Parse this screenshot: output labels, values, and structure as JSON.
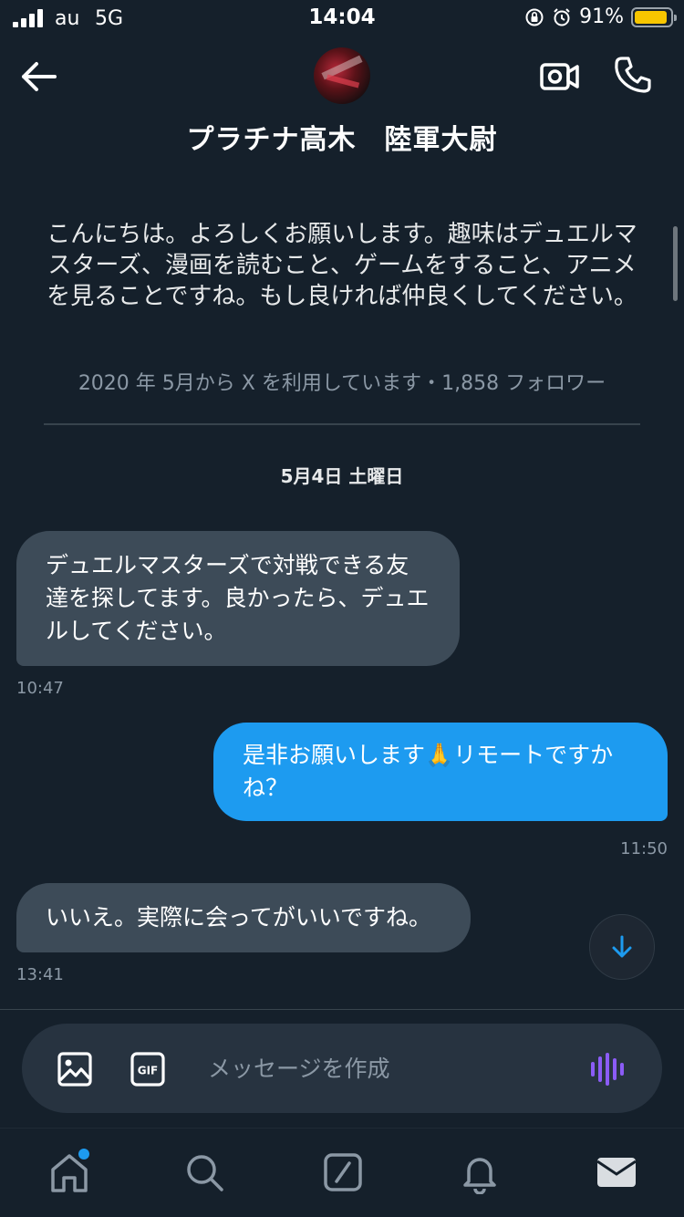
{
  "status_bar": {
    "carrier": "au",
    "network": "5G",
    "time": "14:04",
    "battery_percent": "91%",
    "battery_level": 0.91,
    "battery_color": "#f7c600"
  },
  "header": {
    "contact_name": "プラチナ高木　陸軍大尉",
    "icons": [
      "back-arrow-icon",
      "video-call-icon",
      "phone-icon"
    ]
  },
  "profile": {
    "bio": "こんにちは。よろしくお願いします。趣味はデュエルマスターズ、漫画を読むこと、ゲームをすること、アニメを見ることですね。もし良ければ仲良くしてください。",
    "meta": "2020 年 5月から X を利用しています・1,858 フォロワー"
  },
  "conversation": {
    "date_separator": "5月4日 土曜日",
    "messages": [
      {
        "direction": "incoming",
        "text": "デュエルマスターズで対戦できる友達を探してます。良かったら、デュエルしてください。",
        "time": "10:47"
      },
      {
        "direction": "outgoing",
        "text": "是非お願いします🙏リモートですかね？",
        "time": "11:50"
      },
      {
        "direction": "incoming",
        "text": "いいえ。実際に会ってがいいですね。",
        "time": "13:41"
      }
    ]
  },
  "composer": {
    "placeholder": "メッセージを作成",
    "gif_label": "GIF"
  },
  "tab_bar": {
    "items": [
      "home-icon",
      "search-icon",
      "grok-icon",
      "notifications-icon",
      "messages-icon"
    ],
    "home_has_badge": true
  },
  "colors": {
    "background": "#15202b",
    "incoming_bubble": "#3d4b58",
    "outgoing_bubble": "#1d9bf0",
    "secondary_text": "#8b98a5",
    "voice_accent": "#8b5cf6"
  }
}
